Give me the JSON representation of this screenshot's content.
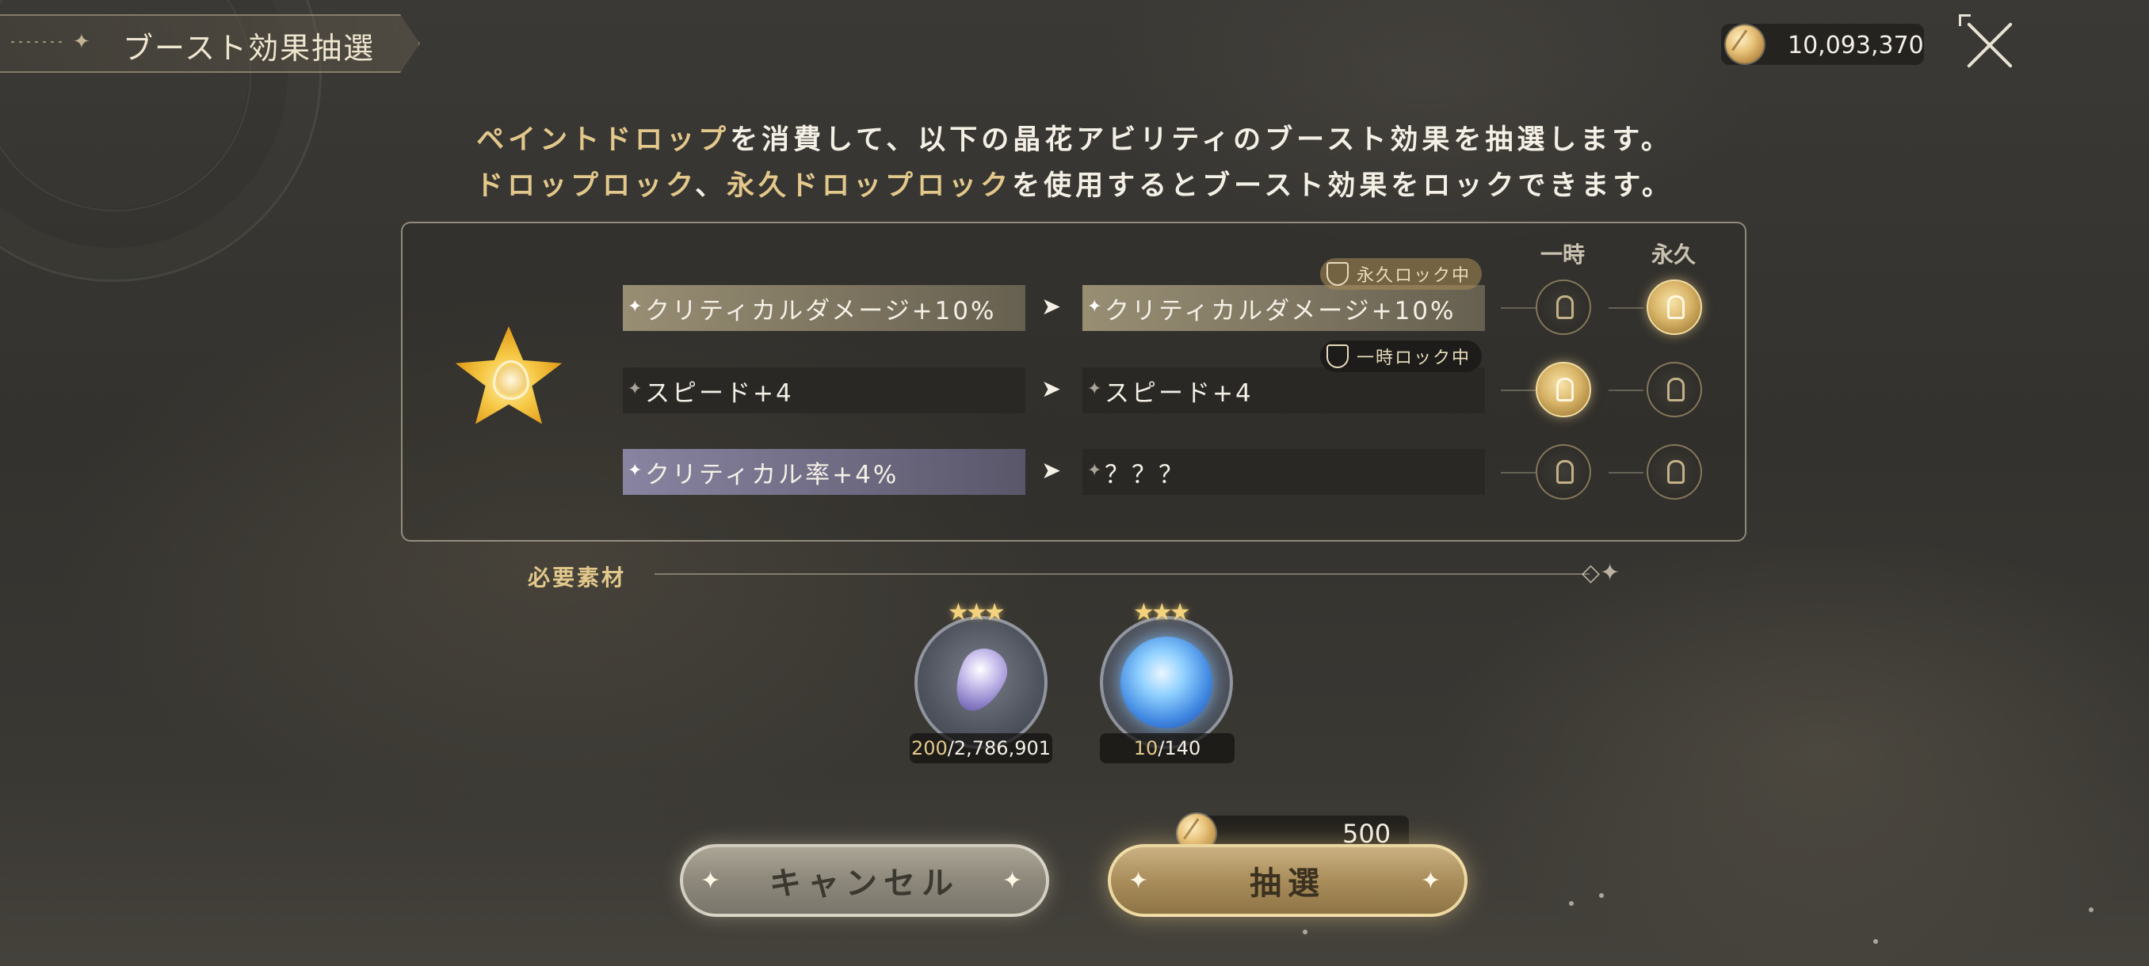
{
  "header": {
    "title": "ブースト効果抽選",
    "currency_value": "10,093,370"
  },
  "description": {
    "line1": [
      {
        "text": "ペイントドロップ",
        "hl": true
      },
      {
        "text": "を消費して、以下の晶花アビリティのブースト効果を抽選します。",
        "hl": false
      }
    ],
    "line2": [
      {
        "text": "ドロップロック",
        "hl": true
      },
      {
        "text": "、",
        "hl": false
      },
      {
        "text": "永久ドロップロック",
        "hl": true
      },
      {
        "text": "を使用するとブースト効果をロックできます。",
        "hl": false
      }
    ]
  },
  "panel": {
    "col_temp": "一時",
    "col_perm": "永久",
    "rows": [
      {
        "current": "クリティカルダメージ+10%",
        "result": "クリティカルダメージ+10%",
        "lock_tag": "永久ロック中"
      },
      {
        "current": "スピード+4",
        "result": "スピード+4",
        "lock_tag": "一時ロック中"
      },
      {
        "current": "クリティカル率+4%",
        "result": "？？？",
        "lock_tag": ""
      }
    ]
  },
  "materials": {
    "label": "必要素材",
    "items": [
      {
        "name": "paint-drop",
        "current": "200",
        "total": "/2,786,901"
      },
      {
        "name": "drop-lock-orb",
        "current": "10",
        "total": "/140"
      }
    ]
  },
  "buttons": {
    "cancel": "キャンセル",
    "draw": "抽選",
    "cost": "500"
  },
  "colors": {
    "accent_gold": "#e3c88b",
    "background": "#3b3935"
  }
}
